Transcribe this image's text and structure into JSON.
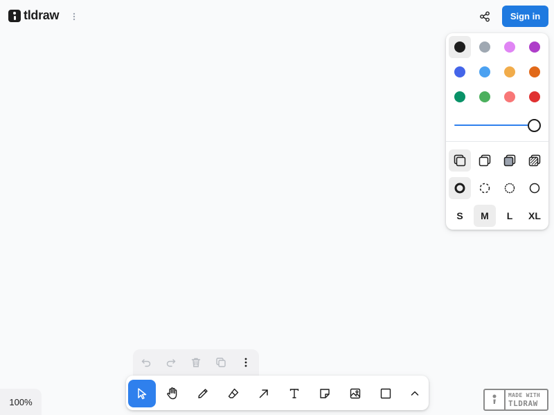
{
  "app": {
    "title": "tldraw"
  },
  "header": {
    "signin_label": "Sign in"
  },
  "style_panel": {
    "colors": [
      {
        "name": "black",
        "hex": "#1d1d1d",
        "active": true
      },
      {
        "name": "grey",
        "hex": "#9fa8b2"
      },
      {
        "name": "light-violet",
        "hex": "#e085f4"
      },
      {
        "name": "violet",
        "hex": "#ae3ec9"
      },
      {
        "name": "blue",
        "hex": "#4465e9"
      },
      {
        "name": "light-blue",
        "hex": "#4ba1f1"
      },
      {
        "name": "yellow",
        "hex": "#f1ac4b"
      },
      {
        "name": "orange",
        "hex": "#e16919"
      },
      {
        "name": "green",
        "hex": "#099268"
      },
      {
        "name": "light-green",
        "hex": "#4cb05e"
      },
      {
        "name": "light-red",
        "hex": "#f87777"
      },
      {
        "name": "red",
        "hex": "#e03131"
      }
    ],
    "opacity": 1.0,
    "fills": [
      {
        "name": "fill-none-icon",
        "active": true
      },
      {
        "name": "fill-semi-icon"
      },
      {
        "name": "fill-solid-icon"
      },
      {
        "name": "fill-pattern-icon"
      }
    ],
    "dashes": [
      {
        "name": "dash-draw-icon",
        "active": true
      },
      {
        "name": "dash-dashed-icon"
      },
      {
        "name": "dash-dotted-icon"
      },
      {
        "name": "dash-solid-icon"
      }
    ],
    "sizes": [
      {
        "label": "S"
      },
      {
        "label": "M",
        "active": true
      },
      {
        "label": "L"
      },
      {
        "label": "XL"
      }
    ]
  },
  "action_bar": [
    "undo-icon",
    "redo-icon",
    "trash-icon",
    "duplicate-icon",
    "more-vertical-icon"
  ],
  "toolbar": {
    "tools": [
      {
        "name": "select-icon",
        "active": true
      },
      {
        "name": "hand-icon"
      },
      {
        "name": "draw-icon"
      },
      {
        "name": "eraser-icon"
      },
      {
        "name": "arrow-icon"
      },
      {
        "name": "text-icon"
      },
      {
        "name": "note-icon"
      },
      {
        "name": "image-icon"
      },
      {
        "name": "rectangle-icon"
      },
      {
        "name": "chevron-up-icon"
      }
    ]
  },
  "zoom": {
    "label": "100%"
  },
  "watermark": {
    "line1": "MADE WITH",
    "line2": "TLDRAW"
  },
  "colors": {
    "accent": "#2f80ed",
    "signin": "#1f7ae0"
  }
}
